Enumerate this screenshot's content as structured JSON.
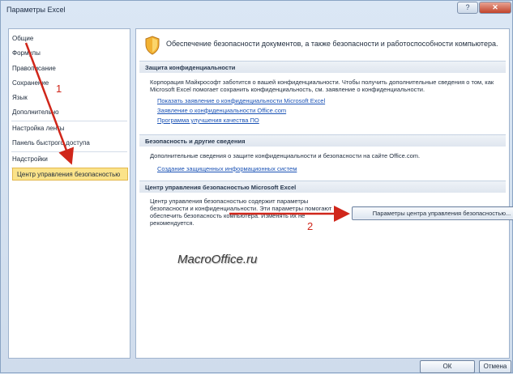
{
  "window": {
    "title": "Параметры Excel",
    "help_glyph": "?",
    "close_glyph": "✕"
  },
  "sidebar": {
    "items": [
      {
        "label": "Общие"
      },
      {
        "label": "Формулы"
      },
      {
        "label": "Правописание"
      },
      {
        "label": "Сохранение"
      },
      {
        "label": "Язык"
      },
      {
        "label": "Дополнительно"
      },
      {
        "label": "Настройка ленты"
      },
      {
        "label": "Панель быстрого доступа"
      },
      {
        "label": "Надстройки"
      },
      {
        "label": "Центр управления безопасностью",
        "selected": true
      }
    ]
  },
  "main": {
    "headline": "Обеспечение безопасности документов, а также безопасности и работоспособности компьютера.",
    "privacy": {
      "header": "Защита конфиденциальности",
      "text": "Корпорация Майкрософт заботится о вашей конфиденциальности. Чтобы получить дополнительные сведения о том, как Microsoft Excel помогает сохранить конфиденциальность, см. заявление о конфиденциальности.",
      "links": [
        "Показать заявление о конфиденциальности Microsoft Excel",
        "Заявление о конфиденциальности Office.com",
        "Программа улучшения качества ПО"
      ]
    },
    "security": {
      "header": "Безопасность и другие сведения",
      "text": "Дополнительные сведения о защите конфиденциальности и безопасности на сайте Office.com.",
      "link": "Создание защищенных информационных систем"
    },
    "trust_center": {
      "header": "Центр управления безопасностью Microsoft Excel",
      "text": "Центр управления безопасностью содержит параметры безопасности и конфиденциальности. Эти параметры помогают обеспечить безопасность компьютера. Изменять их не рекомендуется.",
      "button": "Параметры центра управления безопасностью..."
    }
  },
  "annotations": {
    "marker1": "1",
    "marker2": "2",
    "watermark": "MacroOffice.ru"
  },
  "footer": {
    "ok": "ОК",
    "cancel": "Отмена"
  },
  "colors": {
    "selected_bg": "#fbe38a",
    "arrow": "#d0261a",
    "link": "#1a52b5"
  }
}
